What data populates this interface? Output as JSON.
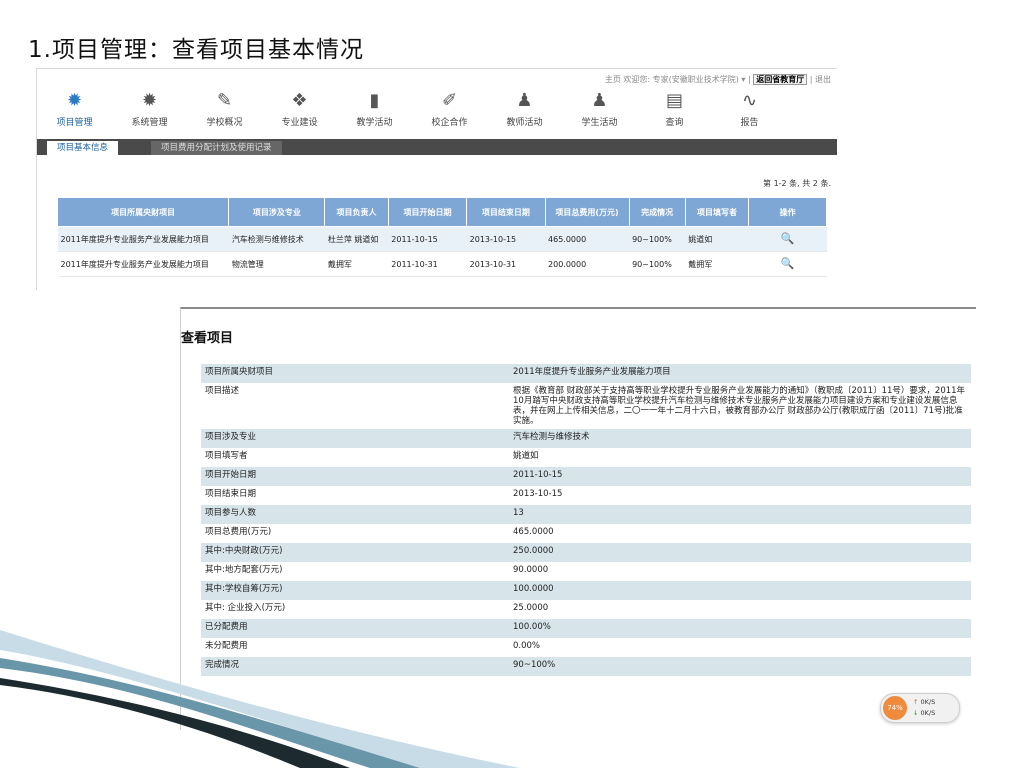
{
  "slide_title": "1.项目管理：查看项目基本情况",
  "top_links": {
    "text": "主页 欢迎您: 专家(安徽职业技术学院) ▾ |",
    "highlight": "返回省教育厅",
    "tail": "| 退出"
  },
  "nav": [
    {
      "label": "项目管理",
      "icon": "gear-icon",
      "glyph": "✹"
    },
    {
      "label": "系统管理",
      "icon": "gear-icon",
      "glyph": "✹"
    },
    {
      "label": "学校概况",
      "icon": "pencil-icon",
      "glyph": "✎"
    },
    {
      "label": "专业建设",
      "icon": "cubes-icon",
      "glyph": "❖"
    },
    {
      "label": "教学活动",
      "icon": "book-icon",
      "glyph": "▮"
    },
    {
      "label": "校企合作",
      "icon": "document-edit-icon",
      "glyph": "✐"
    },
    {
      "label": "教师活动",
      "icon": "person-icon",
      "glyph": "♟"
    },
    {
      "label": "学生活动",
      "icon": "person-icon",
      "glyph": "♟"
    },
    {
      "label": "查询",
      "icon": "monitor-icon",
      "glyph": "▤"
    },
    {
      "label": "报告",
      "icon": "pulse-icon",
      "glyph": "∿"
    }
  ],
  "tabs": [
    "项目基本信息",
    "项目费用分配计划及使用记录"
  ],
  "record_count": "第 1-2 条, 共 2 条.",
  "list_headers": [
    "项目所属央财项目",
    "项目涉及专业",
    "项目负责人",
    "项目开始日期",
    "项目结束日期",
    "项目总费用(万元)",
    "完成情况",
    "项目填写者",
    "操作"
  ],
  "list_rows": [
    [
      "2011年度提升专业服务产业发展能力项目",
      "汽车检测与维修技术",
      "杜兰萍 姚道如",
      "2011-10-15",
      "2013-10-15",
      "465.0000",
      "90~100%",
      "姚道如"
    ],
    [
      "2011年度提升专业服务产业发展能力项目",
      "物流管理",
      "戴拥军",
      "2011-10-31",
      "2013-10-31",
      "200.0000",
      "90~100%",
      "戴拥军"
    ]
  ],
  "detail_title": "查看项目",
  "detail_rows": [
    {
      "k": "项目所属央财项目",
      "v": "2011年度提升专业服务产业发展能力项目"
    },
    {
      "k": "项目描述",
      "v": "根据《教育部 财政部关于支持高等职业学校提升专业服务产业发展能力的通知》（教职成〔2011〕11号）要求，2011年10月踏写中央财政支持高等职业学校提升汽车检测与维修技术专业服务产业发展能力项目建设方案和专业建设发展信息表，并在网上上传相关信息，二〇一一年十二月十六日，被教育部办公厅 财政部办公厅(教职成厅函〔2011〕71号)批准实施。"
    },
    {
      "k": "项目涉及专业",
      "v": "汽车检测与维修技术"
    },
    {
      "k": "项目填写者",
      "v": "姚道如"
    },
    {
      "k": "项目开始日期",
      "v": "2011-10-15"
    },
    {
      "k": "项目结束日期",
      "v": "2013-10-15"
    },
    {
      "k": "项目参与人数",
      "v": "13"
    },
    {
      "k": "项目总费用(万元)",
      "v": "465.0000"
    },
    {
      "k": "其中:中央财政(万元)",
      "v": "250.0000"
    },
    {
      "k": "其中:地方配套(万元)",
      "v": "90.0000"
    },
    {
      "k": "其中:学校自筹(万元)",
      "v": "100.0000"
    },
    {
      "k": "其中: 企业投入(万元)",
      "v": "25.0000"
    },
    {
      "k": "已分配费用",
      "v": "100.00%"
    },
    {
      "k": "未分配费用",
      "v": "0.00%"
    },
    {
      "k": "完成情况",
      "v": "90~100%"
    }
  ],
  "speed_widget": {
    "percent": "74%",
    "up": "0K/S",
    "down": "0K/S"
  }
}
